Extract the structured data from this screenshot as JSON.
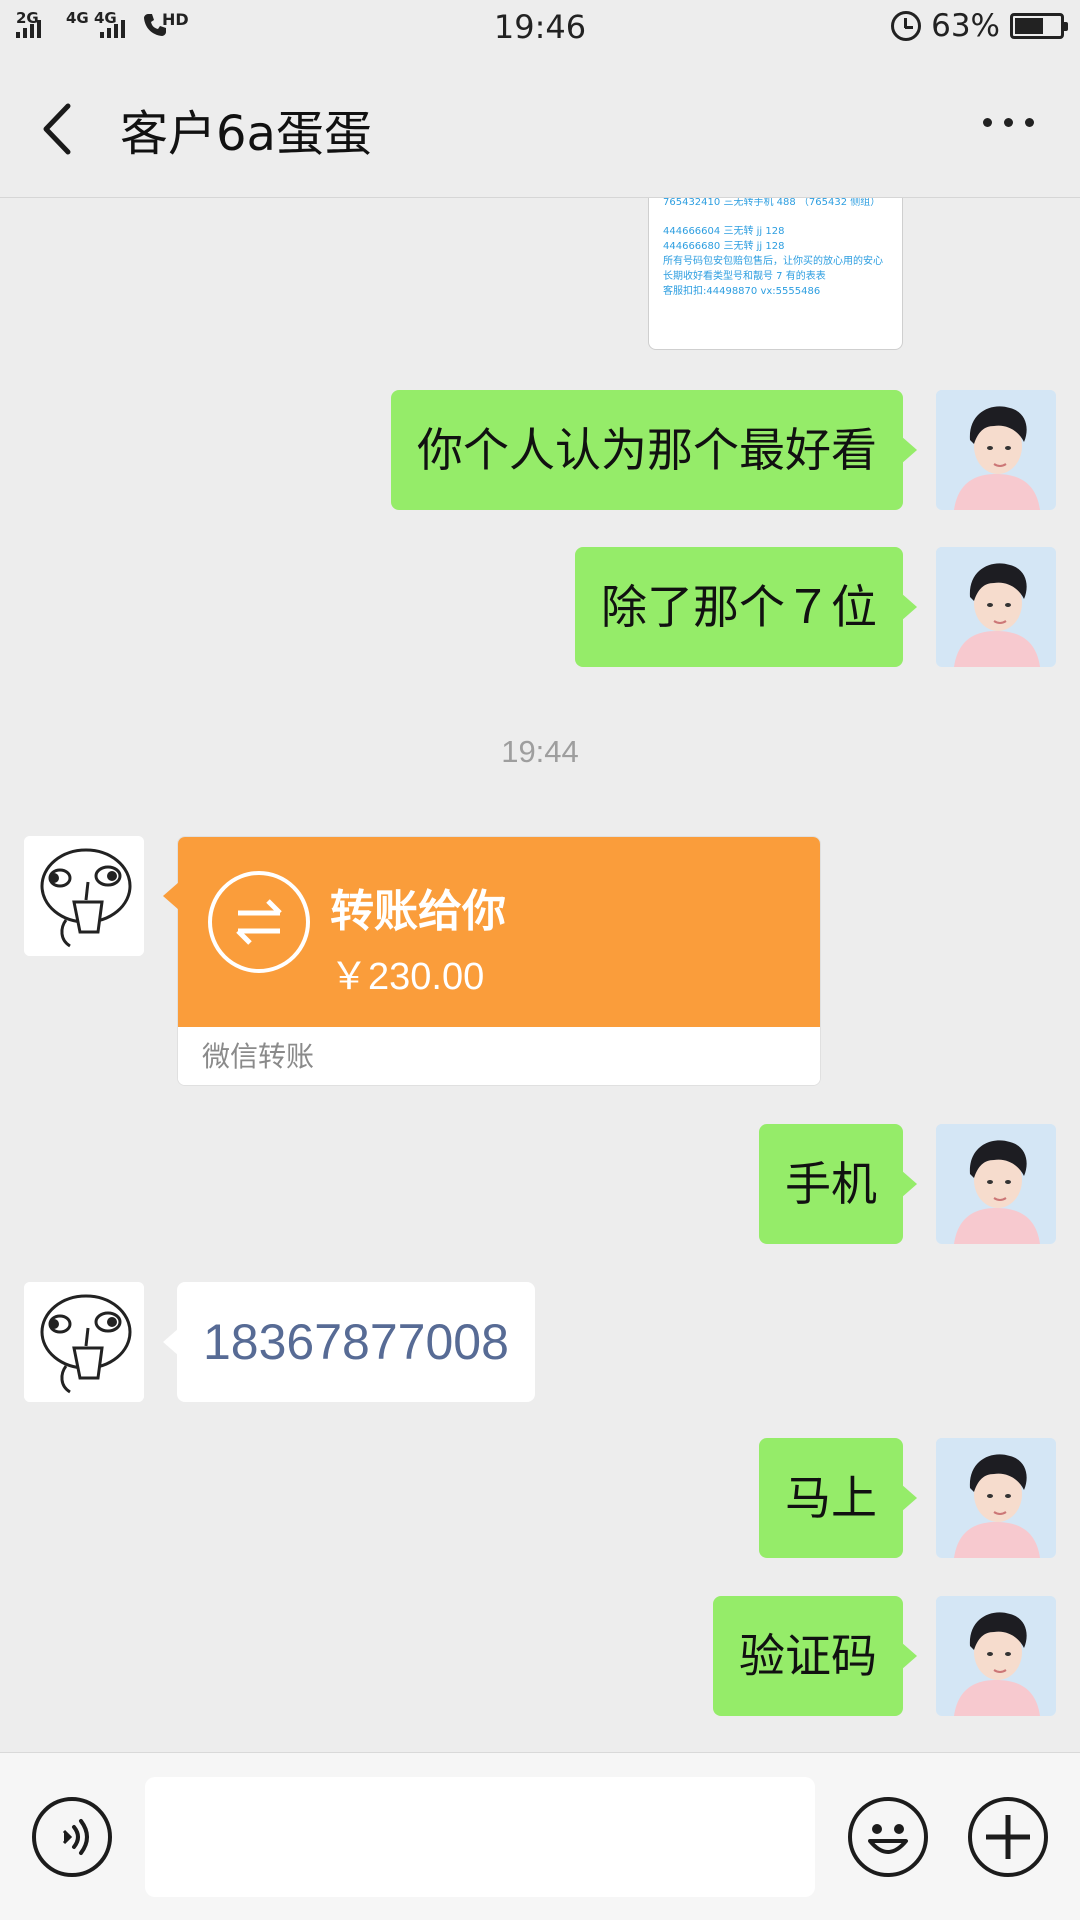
{
  "status_bar": {
    "sim1": "2G",
    "sim2a": "4G",
    "sim2b": "4G",
    "hd": "HD",
    "time": "19:46",
    "battery_percent": "63%",
    "battery_level": 0.63
  },
  "header": {
    "title": "客户6a蛋蛋"
  },
  "image_card": {
    "lines": [
      "765432410        三无转手机  488   （765432 侧组）",
      "",
      "444666604        三无转 jj      128",
      "444666680        三无转 jj      128",
      "所有号码包安包赔包售后，让你买的放心用的安心",
      "长期收好看类型号和靓号 7 有的表表",
      "客服扣扣:44498870      vx:5555486"
    ]
  },
  "messages": [
    {
      "id": "m1",
      "from": "self",
      "text": "你个人认为那个最好看"
    },
    {
      "id": "m2",
      "from": "self",
      "text": "除了那个７位"
    },
    {
      "id": "m3",
      "from": "other",
      "type": "transfer",
      "title": "转账给你",
      "amount": "￥230.00",
      "footer": "微信转账"
    },
    {
      "id": "m4",
      "from": "self",
      "text": "手机"
    },
    {
      "id": "m5",
      "from": "other",
      "text": "18367877008"
    },
    {
      "id": "m6",
      "from": "self",
      "text": "马上"
    },
    {
      "id": "m7",
      "from": "self",
      "text": "验证码"
    }
  ],
  "timestamp": "19:44",
  "input": {
    "voice_icon": "voice-icon",
    "emoji_icon": "emoji-icon",
    "plus_icon": "plus-icon"
  },
  "colors": {
    "self_bubble": "#95ec69",
    "transfer_orange": "#fa9d3b",
    "link_blue": "#576b95",
    "background": "#ededed"
  }
}
